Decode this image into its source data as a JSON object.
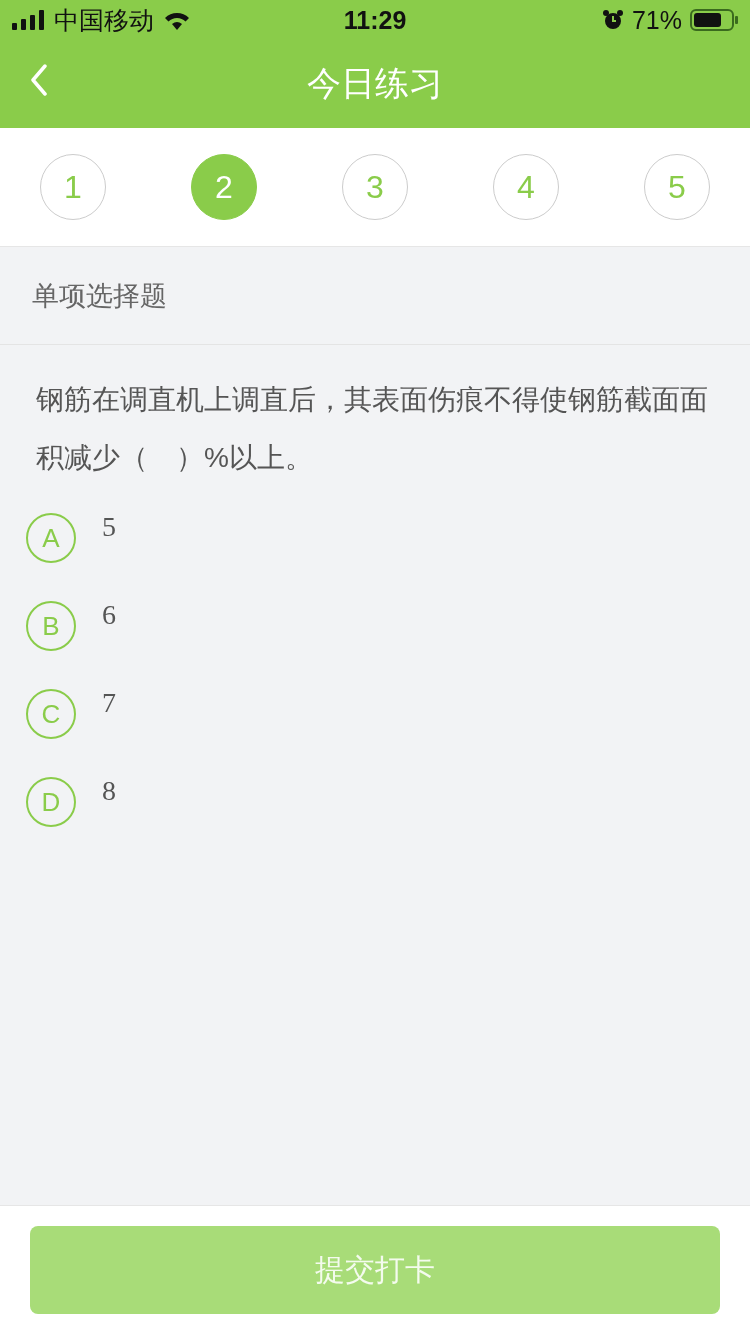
{
  "status_bar": {
    "carrier": "中国移动",
    "time": "11:29",
    "battery": "71%"
  },
  "nav": {
    "title": "今日练习"
  },
  "steps": [
    {
      "label": "1",
      "selected": false
    },
    {
      "label": "2",
      "selected": true
    },
    {
      "label": "3",
      "selected": false
    },
    {
      "label": "4",
      "selected": false
    },
    {
      "label": "5",
      "selected": false
    }
  ],
  "section_title": "单项选择题",
  "question": "钢筋在调直机上调直后，其表面伤痕不得使钢筋截面面积减少（　）%以上。",
  "options": [
    {
      "letter": "A",
      "text": "5",
      "selected": false
    },
    {
      "letter": "B",
      "text": "6",
      "selected": false
    },
    {
      "letter": "C",
      "text": "7",
      "selected": false
    },
    {
      "letter": "D",
      "text": "8",
      "selected": false
    }
  ],
  "submit": {
    "label": "提交打卡",
    "disabled": true
  }
}
